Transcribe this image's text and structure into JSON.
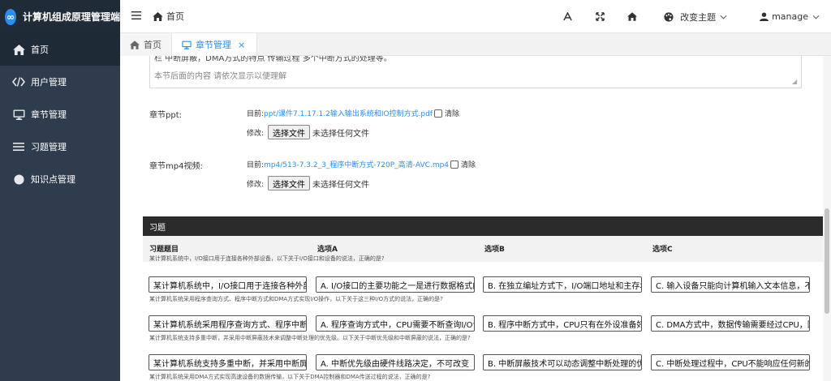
{
  "app": {
    "title": "计算机组成原理管理端",
    "logo_glyph": "∞"
  },
  "sidebar": {
    "items": [
      {
        "label": "首页",
        "icon": "home-icon"
      },
      {
        "label": "用户管理",
        "icon": "code-icon"
      },
      {
        "label": "章节管理",
        "icon": "monitor-icon"
      },
      {
        "label": "习题管理",
        "icon": "list-icon"
      },
      {
        "label": "知识点管理",
        "icon": "circle-icon"
      }
    ]
  },
  "header": {
    "breadcrumb": "首页",
    "theme_label": "改变主题",
    "user_label": "manage"
  },
  "tabs": [
    {
      "label": "首页"
    },
    {
      "label": "章节管理",
      "close": "×"
    }
  ],
  "textarea": {
    "line1": "栏 中断屏蔽，DMA方式的特点 传输过程 多个中断方式的处理等。",
    "line2": "本节后面的内容 请依次显示以便理解"
  },
  "ppt": {
    "label": "章节ppt:",
    "current_prefix": "目前:",
    "current_file": "ppt/课件7.1.17.1.2输入输出系统和IO控制方式.pdf",
    "clear_label": "清除",
    "modify_label": "修改:",
    "choose_button": "选择文件",
    "file_status": "未选择任何文件"
  },
  "video": {
    "label": "章节mp4视频:",
    "current_prefix": "目前:",
    "current_file": "mp4/513-7.3.2_3_程序中断方式-720P_高清-AVC.mp4",
    "clear_label": "清除",
    "modify_label": "修改:",
    "choose_button": "选择文件",
    "file_status": "未选择任何文件"
  },
  "exercises": {
    "section_title": "习题",
    "columns": [
      "习题题目",
      "选项A",
      "选项B",
      "选项C"
    ],
    "header_note": "某计算机系统中，I/O接口用于连接各种外部设备，以下关于I/O接口和设备的说法，正确的是?",
    "rows": [
      {
        "q": "某计算机系统中，I/O接口用于连接各种外部设",
        "a": "A. I/O接口的主要功能之一是进行数据格式的转",
        "b": "B. 在独立编址方式下，I/O端口地址和主存地址",
        "c": "C. 输入设备只能向计算机输入文本信息，不能",
        "note": "某计算机系统采用程序查询方式、程序中断方式和DMA方式实现I/O操作，以下关于这三种I/O方式的说法，正确的是?"
      },
      {
        "q": "某计算机系统采用程序查询方式、程序中断方",
        "a": "A. 程序查询方式中，CPU需要不断查询I/O设备",
        "b": "B. 程序中断方式中，CPU只有在外设准备好数",
        "c": "C. DMA方式中，数据传输需要经过CPU，因此",
        "note": "某计算机系统支持多重中断，并采用中断屏蔽技术来调整中断处理的优先级。以下关于中断优先级和中断屏蔽的说法，正确的是?"
      },
      {
        "q": "某计算机系统支持多重中断，并采用中断屏蔽",
        "a": "A. 中断优先级由硬件线路决定，不可改变",
        "b": "B. 中断屏蔽技术可以动态调整中断处理的优先",
        "c": "C. 中断处理过程中，CPU不能响应任何新的中",
        "note": "某计算机系统采用DMA方式实现高速设备的数据传输，以下关于DMA控制器和DMA传送过程的说法，正确的是?"
      }
    ]
  }
}
